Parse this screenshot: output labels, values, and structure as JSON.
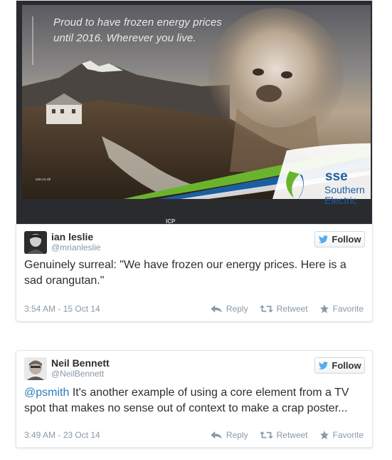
{
  "ad": {
    "headline_line1": "Proud to have frozen energy prices",
    "headline_line2": "until 2016. Wherever you live.",
    "url": "sse.co.uk",
    "brand": "sse",
    "brand_sub_line1": "Southern",
    "brand_sub_line2": "Electric",
    "sign_fragment": "ICP"
  },
  "tweets": [
    {
      "name": "ian leslie",
      "handle": "@mrianleslie",
      "follow_label": "Follow",
      "text": "Genuinely surreal: \"We have frozen our energy prices. Here is a sad orangutan.\"",
      "timestamp": "3:54 AM - 15 Oct 14",
      "reply_label": "Reply",
      "retweet_label": "Retweet",
      "favorite_label": "Favorite"
    },
    {
      "name": "Neil Bennett",
      "handle": "@NeilBennett",
      "follow_label": "Follow",
      "mention": "@psmith",
      "text": " It's another example of using a core element from a TV spot that makes no sense out of context to make a crap poster...",
      "timestamp": "3:49 AM - 23 Oct 14",
      "reply_label": "Reply",
      "retweet_label": "Retweet",
      "favorite_label": "Favorite"
    }
  ],
  "colors": {
    "link": "#2b7bb9",
    "muted": "#8899a6",
    "twitter_blue": "#55acee",
    "brand_blue": "#1c5fa0",
    "brand_green": "#6ab42d"
  }
}
